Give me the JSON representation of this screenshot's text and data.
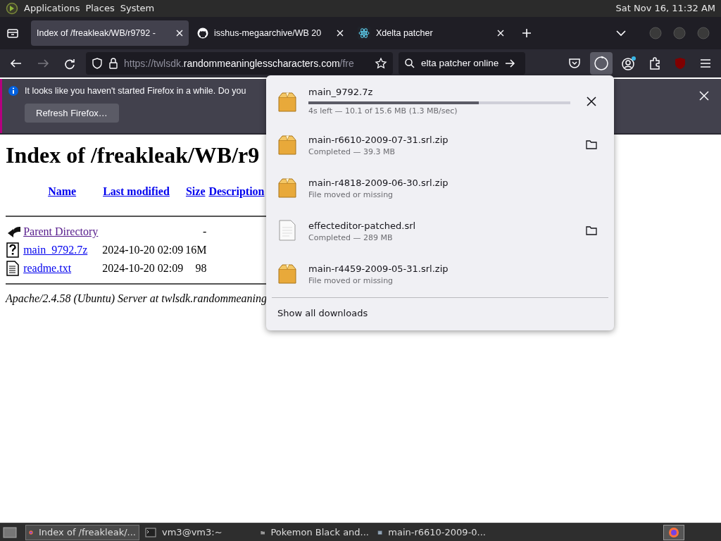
{
  "top_panel": {
    "menus": [
      "Applications",
      "Places",
      "System"
    ],
    "clock": "Sat Nov 16, 11:32 AM"
  },
  "tabs": [
    {
      "label": "Index of /freakleak/WB/r9792 -",
      "selected": true
    },
    {
      "label": "isshus-megaarchive/WB 20",
      "selected": false
    },
    {
      "label": "Xdelta patcher",
      "selected": false
    }
  ],
  "address_bar": {
    "scheme": "https://twlsdk.",
    "domain": "randommeaninglesscharacters.com",
    "path": "/fre"
  },
  "search_field": {
    "value": "elta patcher online"
  },
  "notification": {
    "message": "It looks like you haven't started Firefox in a while. Do you",
    "button": "Refresh Firefox…"
  },
  "page": {
    "heading": "Index of /freakleak/WB/r9",
    "columns": [
      "Name",
      "Last modified",
      "Size",
      "Description"
    ],
    "rows": [
      {
        "kind": "parent",
        "name": "Parent Directory",
        "modified": "",
        "size": "-"
      },
      {
        "kind": "unknown",
        "name": "main_9792.7z",
        "modified": "2024-10-20 02:09",
        "size": "16M"
      },
      {
        "kind": "text",
        "name": "readme.txt",
        "modified": "2024-10-20 02:09",
        "size": "98"
      }
    ],
    "footer": "Apache/2.4.58 (Ubuntu) Server at twlsdk.randommeaning"
  },
  "downloads": {
    "items": [
      {
        "name": "main_9792.7z",
        "kind": "active",
        "status": "4s left — 10.1 of 15.6 MB (1.3 MB/sec)",
        "level": 0.65
      },
      {
        "name": "main-r6610-2009-07-31.srl.zip",
        "kind": "completed",
        "status": "Completed — 39.3 MB"
      },
      {
        "name": "main-r4818-2009-06-30.srl.zip",
        "kind": "missing",
        "status": "File moved or missing"
      },
      {
        "name": "effecteditor-patched.srl",
        "kind": "completed",
        "status": "Completed — 289 MB"
      },
      {
        "name": "main-r4459-2009-05-31.srl.zip",
        "kind": "missing",
        "status": "File moved or missing"
      }
    ],
    "show_all": "Show all downloads"
  },
  "taskbar": [
    {
      "label": "Index of /freakleak/...",
      "selected": true
    },
    {
      "label": "vm3@vm3:~",
      "selected": false
    },
    {
      "label": "Pokemon Black and...",
      "selected": false
    },
    {
      "label": "main-r6610-2009-0...",
      "selected": false
    }
  ]
}
